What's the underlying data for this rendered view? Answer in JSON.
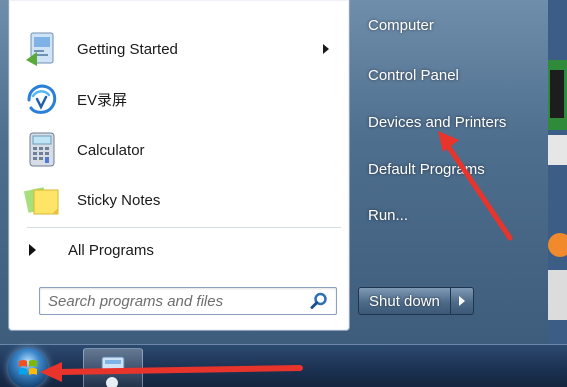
{
  "start_menu": {
    "programs": [
      {
        "label": "Getting Started",
        "icon": "getting-started-icon",
        "has_submenu": true
      },
      {
        "label": "EV录屏",
        "icon": "ev-recorder-icon",
        "has_submenu": false
      },
      {
        "label": "Calculator",
        "icon": "calculator-icon",
        "has_submenu": false
      },
      {
        "label": "Sticky Notes",
        "icon": "sticky-notes-icon",
        "has_submenu": false
      }
    ],
    "all_programs_label": "All Programs",
    "search": {
      "placeholder": "Search programs and files",
      "value": ""
    },
    "right_items": [
      {
        "label": "Computer"
      },
      {
        "label": "Control Panel"
      },
      {
        "label": "Devices and Printers"
      },
      {
        "label": "Default Programs"
      },
      {
        "label": "Run..."
      }
    ],
    "shutdown_label": "Shut down"
  },
  "colors": {
    "annotation_arrow": "#e8342a",
    "menu_frame": "#4f6f8f",
    "taskbar": "#1c3253"
  }
}
